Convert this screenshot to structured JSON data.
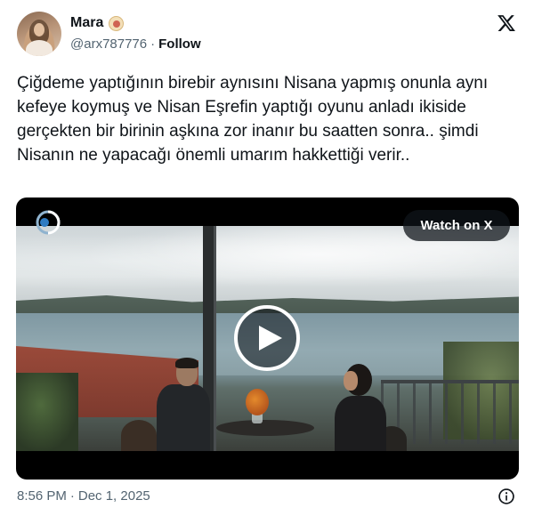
{
  "author": {
    "display_name": "Mara",
    "name_emoji": "bagel-emoji",
    "handle": "@arx787776",
    "separator": "·",
    "follow_label": "Follow"
  },
  "tweet": {
    "text": "Çiğdeme yaptığının birebir aynısını Nisana yapmış onunla aynı kefeye koymuş ve Nisan Eşrefin yaptığı oyunu anladı ikiside gerçekten bir birinin aşkına zor inanır bu saatten sonra.. şimdi Nisanın ne yapacağı önemli umarım hakkettiği verir.."
  },
  "media": {
    "watch_label": "Watch on X",
    "channel_logo": "kanal-d-logo-icon",
    "play_icon": "play-icon"
  },
  "footer": {
    "time": "8:56 PM",
    "separator": "·",
    "date": "Dec 1, 2025"
  },
  "icons": {
    "platform": "x-logo-icon",
    "info": "info-icon"
  },
  "colors": {
    "text_primary": "#0f1419",
    "text_secondary": "#536471",
    "background": "#ffffff",
    "pill_background": "#0f1419"
  }
}
